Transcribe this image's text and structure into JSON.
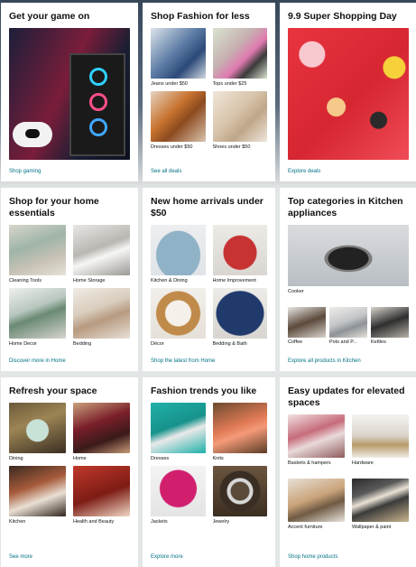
{
  "cards": [
    {
      "title": "Get your game on",
      "link": "Shop gaming"
    },
    {
      "title": "Shop Fashion for less",
      "link": "See all deals",
      "items": [
        {
          "label": "Jeans under $50"
        },
        {
          "label": "Tops under $25"
        },
        {
          "label": "Dresses under $50"
        },
        {
          "label": "Shoes under $50"
        }
      ]
    },
    {
      "title": "9.9 Super Shopping Day",
      "link": "Explore deals"
    },
    {
      "title": "Shop for your home essentials",
      "link": "Discover more in Home",
      "items": [
        {
          "label": "Cleaning Tools"
        },
        {
          "label": "Home Storage"
        },
        {
          "label": "Home Decor"
        },
        {
          "label": "Bedding"
        }
      ]
    },
    {
      "title": "New home arrivals under $50",
      "link": "Shop the latest from Home",
      "items": [
        {
          "label": "Kitchen & Dining"
        },
        {
          "label": "Home Improvement"
        },
        {
          "label": "Décor"
        },
        {
          "label": "Bedding & Bath"
        }
      ]
    },
    {
      "title": "Top categories in Kitchen appliances",
      "link": "Explore all products in Kitchen",
      "main_label": "Cooker",
      "items": [
        {
          "label": "Coffee"
        },
        {
          "label": "Pots and P..."
        },
        {
          "label": "Kettles"
        }
      ]
    },
    {
      "title": "Refresh your space",
      "link": "See more",
      "items": [
        {
          "label": "Dining"
        },
        {
          "label": "Home"
        },
        {
          "label": "Kitchen"
        },
        {
          "label": "Health and Beauty"
        }
      ]
    },
    {
      "title": "Fashion trends you like",
      "link": "Explore more",
      "items": [
        {
          "label": "Dresses"
        },
        {
          "label": "Knits"
        },
        {
          "label": "Jackets"
        },
        {
          "label": "Jewelry"
        }
      ]
    },
    {
      "title": "Easy updates for elevated spaces",
      "link": "Shop home products",
      "items": [
        {
          "label": "Baskets & hampers"
        },
        {
          "label": "Hardware"
        },
        {
          "label": "Accent furniture"
        },
        {
          "label": "Wallpaper & paint"
        }
      ]
    }
  ]
}
